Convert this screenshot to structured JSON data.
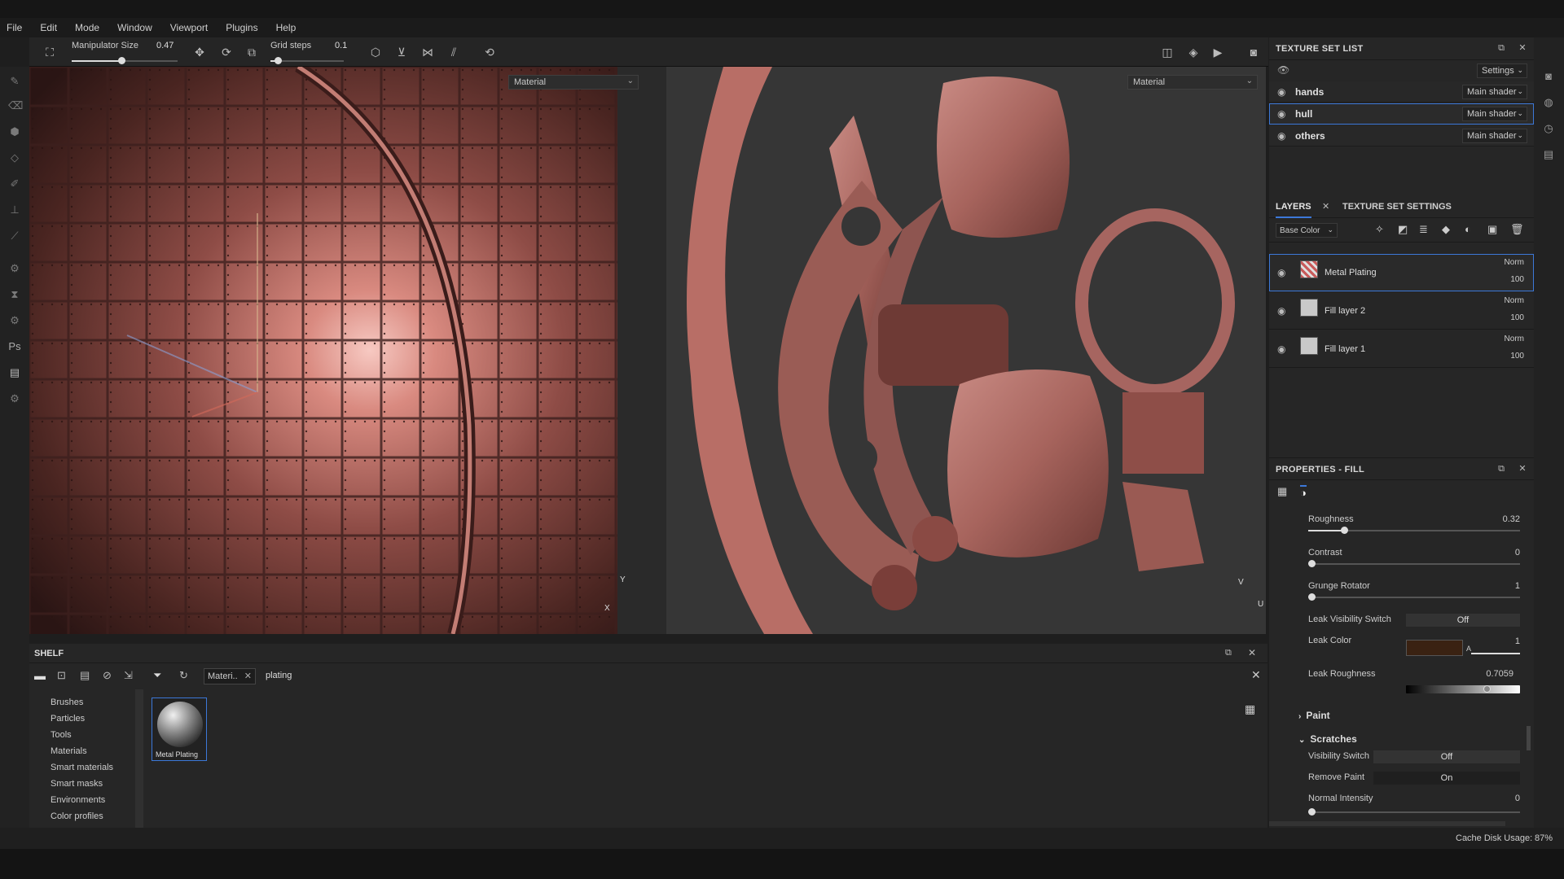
{
  "menu": [
    "File",
    "Edit",
    "Mode",
    "Window",
    "Viewport",
    "Plugins",
    "Help"
  ],
  "toolbar": {
    "manipulator_label": "Manipulator Size",
    "manipulator_value": "0.47",
    "manipulator_fraction": 0.47,
    "grid_label": "Grid steps",
    "grid_value": "0.1",
    "grid_fraction": 0.1
  },
  "viewport3d": {
    "mode": "Material",
    "axis_y": "Y",
    "axis_x": "X"
  },
  "viewport2d": {
    "mode": "Material",
    "axis_v": "V",
    "axis_u": "U"
  },
  "texture_set_list": {
    "title": "TEXTURE SET LIST",
    "settings_label": "Settings",
    "rows": [
      {
        "name": "hands",
        "shader": "Main shader",
        "selected": false
      },
      {
        "name": "hull",
        "shader": "Main shader",
        "selected": true
      },
      {
        "name": "others",
        "shader": "Main shader",
        "selected": false
      }
    ]
  },
  "layers_panel": {
    "tab_layers": "LAYERS",
    "tab_settings": "TEXTURE SET SETTINGS",
    "channel": "Base Color",
    "layers": [
      {
        "name": "Metal Plating",
        "blend": "Norm",
        "opacity": "100",
        "selected": true
      },
      {
        "name": "Fill layer 2",
        "blend": "Norm",
        "opacity": "100",
        "selected": false
      },
      {
        "name": "Fill layer 1",
        "blend": "Norm",
        "opacity": "100",
        "selected": false
      }
    ]
  },
  "properties": {
    "title": "PROPERTIES - FILL",
    "roughness_label": "Roughness",
    "roughness_value": "0.32",
    "roughness_fraction": 0.17,
    "contrast_label": "Contrast",
    "contrast_value": "0",
    "contrast_fraction": 0,
    "grunge_label": "Grunge Rotator",
    "grunge_value": "1",
    "grunge_fraction": 0,
    "leak_vis_label": "Leak Visibility Switch",
    "leak_vis_value": "Off",
    "leak_color_label": "Leak Color",
    "leak_color_swatch": "#3a2212",
    "leak_color_a": "A",
    "leak_color_a_value": "1",
    "leak_rough_label": "Leak Roughness",
    "leak_rough_value": "0.7059",
    "leak_rough_fraction": 0.7059,
    "paint_section": "Paint",
    "scratches_section": "Scratches",
    "vis_switch_label": "Visibility Switch",
    "vis_switch_value": "Off",
    "remove_paint_label": "Remove Paint",
    "remove_paint_value": "On",
    "normal_int_label": "Normal Intensity",
    "normal_int_value": "0",
    "normal_int_fraction": 0
  },
  "shelf": {
    "title": "SHELF",
    "filter_tag": "Materi..",
    "search_text": "plating",
    "categories": [
      "Brushes",
      "Particles",
      "Tools",
      "Materials",
      "Smart materials",
      "Smart masks",
      "Environments",
      "Color profiles"
    ],
    "items": [
      {
        "name": "Metal Plating"
      }
    ]
  },
  "status": {
    "cache_label": "Cache Disk Usage:",
    "cache_value": "87%"
  }
}
